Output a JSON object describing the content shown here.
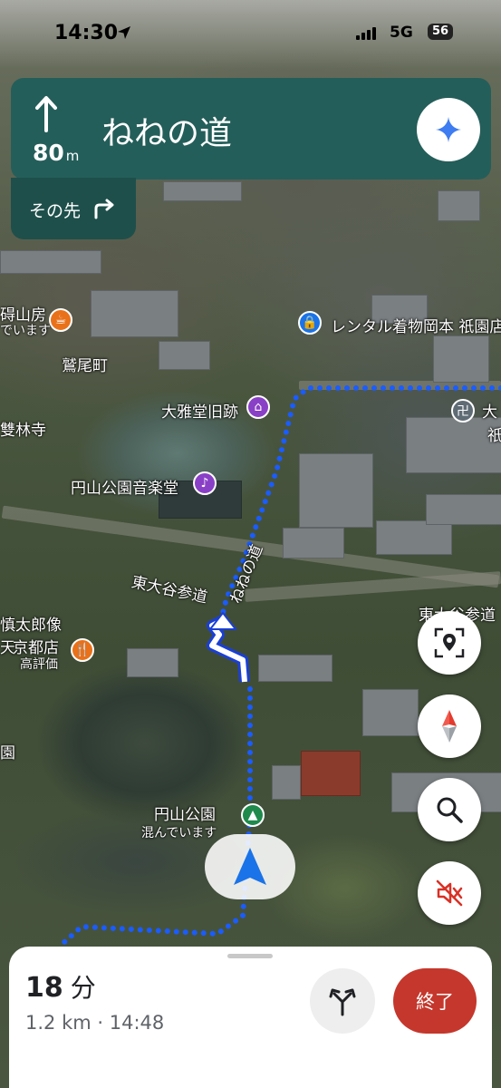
{
  "status_bar": {
    "time": "14:30",
    "network": "5G",
    "battery": "56"
  },
  "navigation": {
    "distance_value": "80",
    "distance_unit": "m",
    "street": "ねねの道",
    "then_label": "その先"
  },
  "map_labels": {
    "cafe_partial_1": "碍山房",
    "cafe_partial_2": "でいます",
    "washio": "鷲尾町",
    "soryinji": "雙林寺",
    "daigado": "大雅堂旧跡",
    "music_hall": "円山公園音楽堂",
    "higashi_otani_left": "東大谷参道",
    "higashi_otani_right": "東大谷参道",
    "nene_road": "ねねの道",
    "rental_kimono": "レンタル着物岡本 祇園店",
    "temple_partial": "大",
    "temple_partial_2": "祇",
    "shintaro": "慎太郎像",
    "restaurant": "京都店",
    "restaurant_partial": "天",
    "restaurant_sub": "高評価",
    "park": "円山公園",
    "park_sub": "混んでいます",
    "edge_partial": "園"
  },
  "trip": {
    "minutes": "18",
    "minutes_unit": "分",
    "distance_eta": "1.2 km · 14:48",
    "end_label": "終了"
  },
  "colors": {
    "nav_card": "#245e5a",
    "route": "#1a5cff",
    "end_button": "#c5372c"
  }
}
